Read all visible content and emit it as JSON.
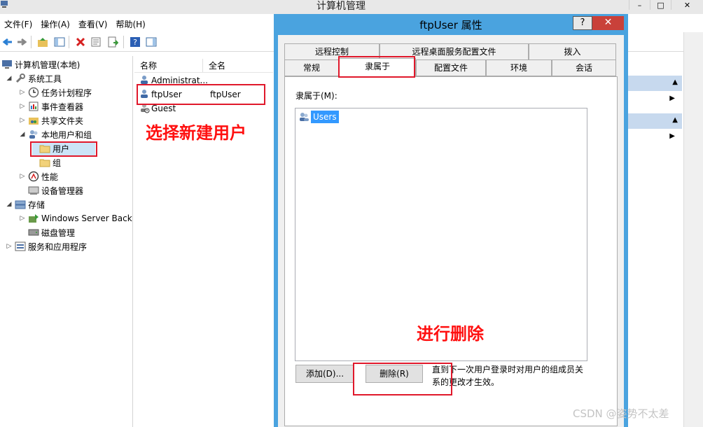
{
  "window": {
    "title": "计算机管理",
    "controls": [
      "–",
      "□",
      "✕"
    ]
  },
  "menu": [
    {
      "label": "文件(F)"
    },
    {
      "label": "操作(A)"
    },
    {
      "label": "查看(V)"
    },
    {
      "label": "帮助(H)"
    }
  ],
  "tree": {
    "root": "计算机管理(本地)",
    "system_tools": "系统工具",
    "task_scheduler": "任务计划程序",
    "event_viewer": "事件查看器",
    "shared_folders": "共享文件夹",
    "local_users_groups": "本地用户和组",
    "users": "用户",
    "groups": "组",
    "performance": "性能",
    "device_manager": "设备管理器",
    "storage": "存储",
    "windows_backup": "Windows Server Back",
    "disk_management": "磁盘管理",
    "services_apps": "服务和应用程序"
  },
  "list": {
    "col_name": "名称",
    "col_fullname": "全名",
    "rows": [
      {
        "name": "Administrat...",
        "fullname": ""
      },
      {
        "name": "ftpUser",
        "fullname": "ftpUser"
      },
      {
        "name": "Guest",
        "fullname": ""
      }
    ]
  },
  "dialog": {
    "title": "ftpUser 属性",
    "help": "?",
    "close": "✕",
    "tabs_row1": [
      "远程控制",
      "远程桌面服务配置文件",
      "拨入"
    ],
    "tabs_row2": [
      "常规",
      "隶属于",
      "配置文件",
      "环境",
      "会话"
    ],
    "member_of_label": "隶属于(M):",
    "members": [
      "Users"
    ],
    "add_button": "添加(D)...",
    "remove_button": "删除(R)",
    "note": "直到下一次用户登录时对用户的组成员关系的更改才生效。"
  },
  "annotations": {
    "select_user": "选择新建用户",
    "do_delete": "进行删除"
  },
  "watermark": "CSDN @姿势不太差",
  "colors": {
    "accent": "#4aa3df",
    "annotation": "#e0182b",
    "selection": "#3399ff"
  }
}
